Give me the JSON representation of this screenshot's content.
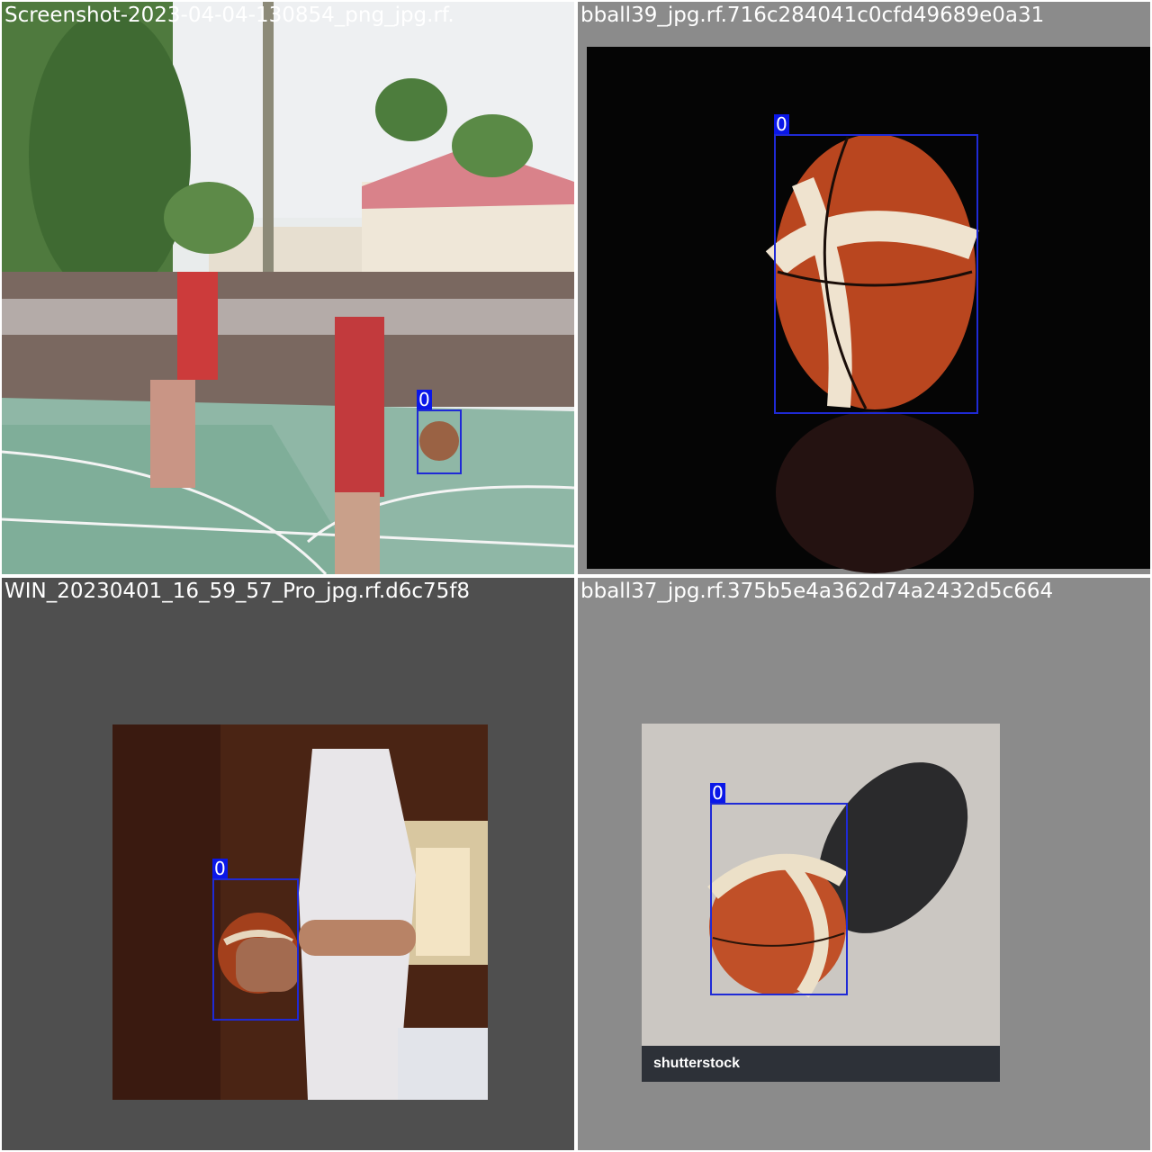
{
  "tiles": [
    {
      "filename": "Screenshot-2023-04-04-130854_png_jpg.rf.",
      "detections": [
        {
          "label": "0"
        }
      ]
    },
    {
      "filename": "bball39_jpg.rf.716c284041c0cfd49689e0a31",
      "detections": [
        {
          "label": "0"
        }
      ]
    },
    {
      "filename": "WIN_20230401_16_59_57_Pro_jpg.rf.d6c75f8",
      "detections": [
        {
          "label": "0"
        }
      ]
    },
    {
      "filename": "bball37_jpg.rf.375b5e4a362d74a2432d5c664",
      "detections": [
        {
          "label": "0"
        }
      ],
      "watermark": "shutterstock"
    }
  ],
  "colors": {
    "box": "#1f2ad6",
    "label_bg": "#0a17e8"
  }
}
